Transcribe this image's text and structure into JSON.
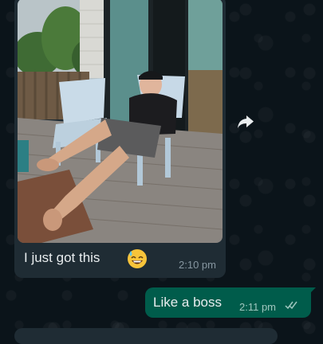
{
  "messages": [
    {
      "direction": "incoming",
      "media": "photo",
      "text": "I just got this",
      "emoji": "sweat-smile-emoji",
      "time": "2:10 pm"
    },
    {
      "direction": "outgoing",
      "text": "Like a boss",
      "time": "2:11 pm",
      "status": "read-double-tick-icon"
    }
  ],
  "colors": {
    "background": "#0b141a",
    "incoming_bubble": "#1f2c34",
    "outgoing_bubble": "#005c4b",
    "text": "#e9edef",
    "timestamp": "#8696a0"
  }
}
